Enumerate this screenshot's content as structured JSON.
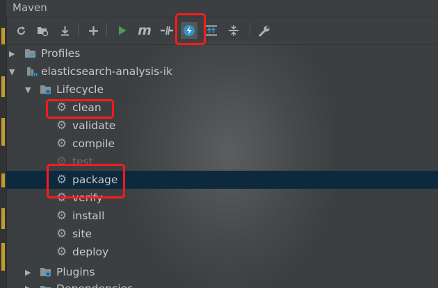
{
  "header": {
    "title": "Maven"
  },
  "toolbar": {
    "buttons": [
      {
        "name": "reload-all-icon",
        "glyph": "⟳"
      },
      {
        "name": "generate-sources-icon",
        "glyph": "⟲"
      },
      {
        "name": "download-sources-icon",
        "glyph": "⤓"
      },
      {
        "name": "add-maven-project-icon",
        "glyph": "+"
      },
      {
        "name": "run-maven-build-icon",
        "glyph": "▶"
      },
      {
        "name": "execute-maven-goal-icon",
        "glyph": "m"
      },
      {
        "name": "toggle-offline-mode-icon",
        "glyph": "⫽"
      },
      {
        "name": "skip-tests-icon",
        "glyph": "⚡"
      },
      {
        "name": "show-dependencies-icon",
        "glyph": "⇅"
      },
      {
        "name": "collapse-all-icon",
        "glyph": "≑"
      },
      {
        "name": "maven-settings-icon",
        "glyph": "🔧"
      }
    ]
  },
  "tree": {
    "profiles": "Profiles",
    "project": "elasticsearch-analysis-ik",
    "lifecycle": "Lifecycle",
    "goals": [
      "clean",
      "validate",
      "compile",
      "test",
      "package",
      "verify",
      "install",
      "site",
      "deploy"
    ],
    "plugins": "Plugins",
    "dependencies": "Dependencies"
  },
  "colors": {
    "background": "#3c3f41",
    "selection": "#0d293e",
    "highlight": "#ff1a1a",
    "run": "#499c54",
    "accent": "#3592c4"
  }
}
